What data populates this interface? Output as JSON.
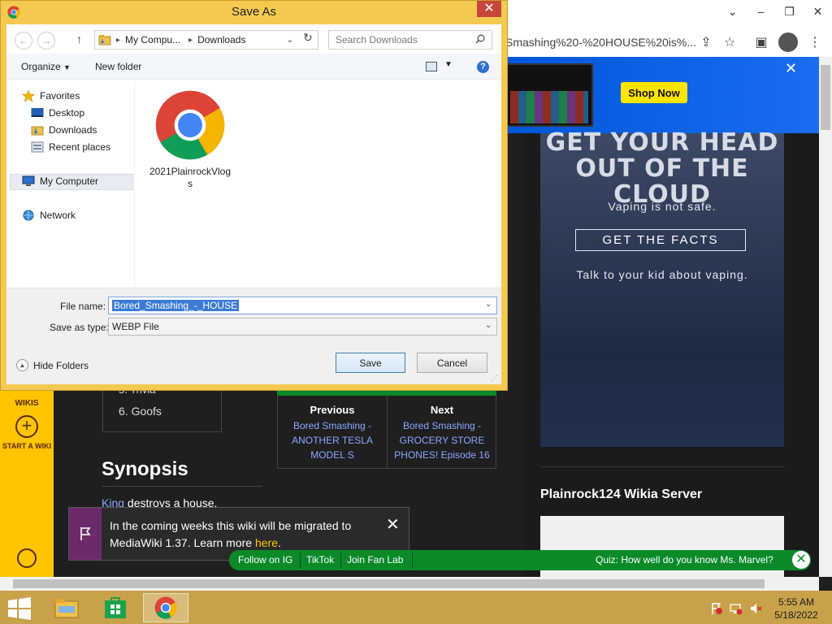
{
  "browser": {
    "url_text": "Smashing%20-%20HOUSE%20is%...",
    "window_controls": {
      "collapse": "⌄",
      "minimize": "–",
      "restore": "❐",
      "close": "✕"
    }
  },
  "ad_banner": {
    "cta": "Shop Now",
    "close": "✕"
  },
  "vape_ad": {
    "headline": "GET YOUR HEAD OUT OF THE CLOUD",
    "subtitle": "Vaping is not safe.",
    "button": "GET THE FACTS",
    "talk": "Talk to your kid about vaping."
  },
  "sidebar": {
    "wikis": "WIKIS",
    "start_a_wiki": "START A WIKI"
  },
  "toc": {
    "trivia": "5. Trivia",
    "goofs": "6. Goofs"
  },
  "episode_nav": {
    "previous_label": "Previous",
    "previous_link": "Bored Smashing - ANOTHER TESLA MODEL S",
    "next_label": "Next",
    "next_link": "Bored Smashing - GROCERY STORE PHONES! Episode 16"
  },
  "synopsis": {
    "heading": "Synopsis",
    "link": "King",
    "text": " destroys a house."
  },
  "notice": {
    "text_before": "In the coming weeks this wiki will be migrated to MediaWiki 1.37. Learn more ",
    "link": "here",
    "text_after": ".",
    "close": "✕"
  },
  "right_rail": {
    "server_title": "Plainrock124 Wikia Server"
  },
  "green_bar": {
    "items": [
      "Follow on IG",
      "TikTok",
      "Join Fan Lab"
    ],
    "quiz": "Quiz: How well do you know Ms. Marvel?",
    "close": "✕"
  },
  "taskbar": {
    "time": "5:55 AM",
    "date": "5/18/2022"
  },
  "dialog": {
    "title": "Save As",
    "close": "✕",
    "breadcrumb": [
      "My Compu...",
      "Downloads"
    ],
    "search_placeholder": "Search Downloads",
    "organize": "Organize",
    "new_folder": "New folder",
    "nav": {
      "favorites": "Favorites",
      "desktop": "Desktop",
      "downloads": "Downloads",
      "recent_places": "Recent places",
      "my_computer": "My Computer",
      "network": "Network"
    },
    "file_item": "2021PlainrockVlogs",
    "file_name_label": "File name:",
    "file_name_value": "Bored_Smashing_-_HOUSE",
    "save_as_type_label": "Save as type:",
    "save_as_type_value": "WEBP File",
    "hide_folders": "Hide Folders",
    "save": "Save",
    "cancel": "Cancel"
  },
  "colors": {
    "dialog_frame": "#f5c950",
    "accent_green": "#0a8a28",
    "fandom_yellow": "#ffc500",
    "link_blue": "#8aa8ff"
  }
}
